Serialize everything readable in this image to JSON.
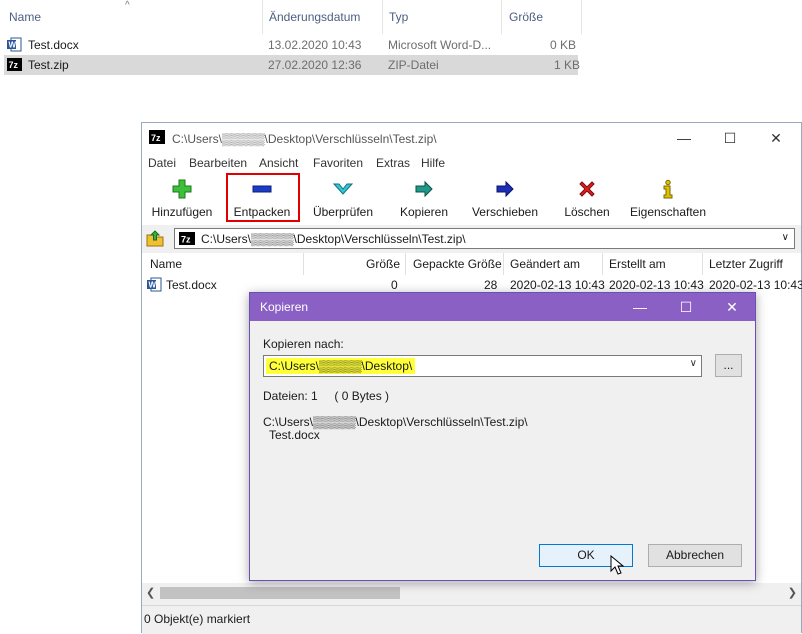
{
  "explorer": {
    "columns": [
      "Name",
      "Änderungsdatum",
      "Typ",
      "Größe"
    ],
    "rows": [
      {
        "name": "Test.docx",
        "date": "13.02.2020 10:43",
        "type": "Microsoft Word-D...",
        "size": "0 KB",
        "selected": false
      },
      {
        "name": "Test.zip",
        "date": "27.02.2020 12:36",
        "type": "ZIP-Datei",
        "size": "1 KB",
        "selected": true
      }
    ]
  },
  "sevenzip": {
    "title": "C:\\Users\\▒▒▒▒▒\\Desktop\\Verschlüsseln\\Test.zip\\",
    "menu": [
      "Datei",
      "Bearbeiten",
      "Ansicht",
      "Favoriten",
      "Extras",
      "Hilfe"
    ],
    "toolbar": [
      "Hinzufügen",
      "Entpacken",
      "Überprüfen",
      "Kopieren",
      "Verschieben",
      "Löschen",
      "Eigenschaften"
    ],
    "address": "C:\\Users\\▒▒▒▒▒\\Desktop\\Verschlüsseln\\Test.zip\\",
    "list_columns": [
      "Name",
      "Größe",
      "Gepackte Größe",
      "Geändert am",
      "Erstellt am",
      "Letzter Zugriff"
    ],
    "list_rows": [
      {
        "name": "Test.docx",
        "size": "0",
        "packed": "28",
        "modified": "2020-02-13 10:43",
        "created": "2020-02-13 10:43",
        "accessed": "2020-02-13 10:43"
      }
    ],
    "status": "0 Objekt(e) markiert"
  },
  "dialog": {
    "title": "Kopieren",
    "copy_to_label": "Kopieren nach:",
    "copy_to_value": "C:\\Users\\▒▒▒▒▒\\Desktop\\",
    "browse_label": "...",
    "files_info": "Dateien: 1     ( 0 Bytes )",
    "source_path": "C:\\Users\\▒▒▒▒▒\\Desktop\\Verschlüsseln\\Test.zip\\",
    "source_file": "Test.docx",
    "ok_label": "OK",
    "cancel_label": "Abbrechen"
  },
  "colors": {
    "dialog_title": "#8a60c5",
    "highlight_red": "#e00000",
    "path_highlight": "#ffff3a",
    "selection_gray": "#d9d9d9"
  }
}
